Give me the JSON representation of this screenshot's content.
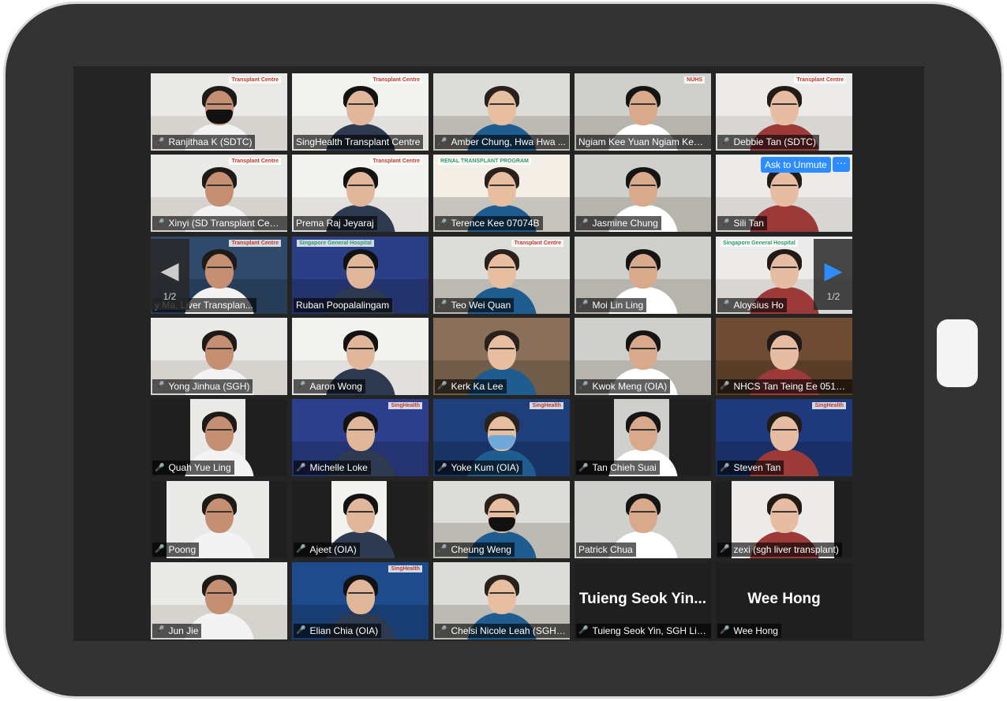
{
  "meeting": {
    "prev_page": "1/2",
    "next_page": "1/2",
    "ask_to_unmute": "Ask to Unmute",
    "more_options": "···"
  },
  "participants": [
    {
      "name": "Ranjithaa K (SDTC)",
      "muted": true,
      "logo": "Transplant Centre"
    },
    {
      "name": "SingHealth Transplant Centre",
      "muted": false,
      "logo": "Transplant Centre",
      "active": true
    },
    {
      "name": "Amber Chung, Hwa Hwa ...",
      "muted": true
    },
    {
      "name": "Ngiam Kee Yuan Ngiam Kee ...",
      "muted": false,
      "logo": "NUHS"
    },
    {
      "name": "Debbie Tan (SDTC)",
      "muted": true,
      "logo": "Transplant Centre"
    },
    {
      "name": "Xinyi (SD Transplant Cent...",
      "muted": true,
      "logo": "Transplant Centre"
    },
    {
      "name": "Prema Raj Jeyaraj",
      "muted": false,
      "logo": "Transplant Centre"
    },
    {
      "name": "Terence Kee 07074B",
      "muted": true,
      "logo": "RENAL TRANSPLANT PROGRAM"
    },
    {
      "name": "Jasmine Chung",
      "muted": true
    },
    {
      "name": "Sili Tan",
      "muted": true,
      "unmute": true
    },
    {
      "name": "y Ma, Liver Transplan...",
      "muted": false,
      "logo": "Transplant Centre"
    },
    {
      "name": "Ruban Poopalalingam",
      "muted": false,
      "logo": "Singapore General Hospital"
    },
    {
      "name": "Teo Wei Quan",
      "muted": true,
      "logo": "Transplant Centre"
    },
    {
      "name": "Moi Lin Ling",
      "muted": true
    },
    {
      "name": "Aloysius Ho",
      "muted": true,
      "logo": "Singapore General Hospital"
    },
    {
      "name": "Yong Jinhua (SGH)",
      "muted": true
    },
    {
      "name": "Aaron Wong",
      "muted": true
    },
    {
      "name": "Kerk Ka Lee",
      "muted": true
    },
    {
      "name": "Kwok Meng (OIA)",
      "muted": true
    },
    {
      "name": "NHCS Tan Teing Ee 05101B",
      "muted": true
    },
    {
      "name": "Quah Yue Ling",
      "muted": true
    },
    {
      "name": "Michelle Loke",
      "muted": true,
      "logo": "SingHealth"
    },
    {
      "name": "Yoke Kum (OIA)",
      "muted": true,
      "logo": "SingHealth"
    },
    {
      "name": "Tan Chieh Suai",
      "muted": true
    },
    {
      "name": "Steven Tan",
      "muted": true,
      "logo": "SingHealth"
    },
    {
      "name": "Poong",
      "muted": true
    },
    {
      "name": "Ajeet (OIA)",
      "muted": true
    },
    {
      "name": "Cheung Weng",
      "muted": true
    },
    {
      "name": "Patrick Chua",
      "muted": false
    },
    {
      "name": "zexi (sgh liver transplant)",
      "muted": true
    },
    {
      "name": "Jun Jie",
      "muted": true
    },
    {
      "name": "Elian Chia (OIA)",
      "muted": true,
      "logo": "SingHealth"
    },
    {
      "name": "Chelsi Nicole Leah (SGH ...",
      "muted": true
    },
    {
      "name": "Tuieng Seok Yin, SGH Liv...",
      "muted": true,
      "display_name": "Tuieng Seok Yin..."
    },
    {
      "name": "Wee Hong",
      "muted": true,
      "display_name": "Wee Hong"
    }
  ],
  "colors": {
    "active_speaker_border": "#a6e15c",
    "muted_mic": "#e0353a",
    "unmute_button": "#2d8cff",
    "tablet_frame": "#333333"
  }
}
